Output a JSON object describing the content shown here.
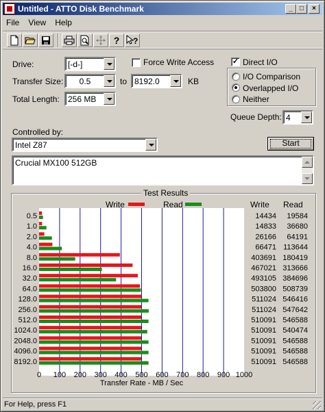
{
  "window": {
    "title": "Untitled - ATTO Disk Benchmark",
    "btn_min": "_",
    "btn_max": "□",
    "btn_close": "×"
  },
  "menu": {
    "file": "File",
    "view": "View",
    "help": "Help"
  },
  "toolbar": {
    "icons": [
      "new-document-icon",
      "open-folder-icon",
      "save-disk-icon",
      "print-icon",
      "print-preview-icon",
      "move-cross-icon",
      "help-question-icon",
      "context-help-icon"
    ]
  },
  "form": {
    "drive_label": "Drive:",
    "drive_value": "[-d-]",
    "force_write_label": "Force Write Access",
    "force_write_checked": false,
    "direct_io_label": "Direct I/O",
    "direct_io_checked": true,
    "transfer_size_label": "Transfer Size:",
    "transfer_from": "0.5",
    "to_label": "to",
    "transfer_to": "8192.0",
    "kb_label": "KB",
    "total_length_label": "Total Length:",
    "total_length_value": "256 MB",
    "io_comparison_label": "I/O Comparison",
    "overlapped_io_label": "Overlapped I/O",
    "neither_label": "Neither",
    "selected_mode": "Overlapped I/O",
    "queue_depth_label": "Queue Depth:",
    "queue_depth_value": "4",
    "controlled_by_label": "Controlled by:",
    "controlled_by_value": "Intel Z87",
    "start_button": "Start",
    "description": "Crucial MX100 512GB"
  },
  "results": {
    "title": "Test Results",
    "write_legend": "Write",
    "read_legend": "Read",
    "write_col_header": "Write",
    "read_col_header": "Read",
    "rows": [
      {
        "size": "0.5",
        "write": "14434",
        "read": "19584"
      },
      {
        "size": "1.0",
        "write": "14833",
        "read": "36680"
      },
      {
        "size": "2.0",
        "write": "26166",
        "read": "64191"
      },
      {
        "size": "4.0",
        "write": "66471",
        "read": "113644"
      },
      {
        "size": "8.0",
        "write": "403691",
        "read": "180419"
      },
      {
        "size": "16.0",
        "write": "467021",
        "read": "313666"
      },
      {
        "size": "32.0",
        "write": "493105",
        "read": "384696"
      },
      {
        "size": "64.0",
        "write": "503800",
        "read": "508739"
      },
      {
        "size": "128.0",
        "write": "511024",
        "read": "546416"
      },
      {
        "size": "256.0",
        "write": "511024",
        "read": "547642"
      },
      {
        "size": "512.0",
        "write": "510091",
        "read": "546588"
      },
      {
        "size": "1024.0",
        "write": "510091",
        "read": "540474"
      },
      {
        "size": "2048.0",
        "write": "510091",
        "read": "546588"
      },
      {
        "size": "4096.0",
        "write": "510091",
        "read": "546588"
      },
      {
        "size": "8192.0",
        "write": "510091",
        "read": "546588"
      }
    ]
  },
  "chart_data": {
    "type": "bar",
    "orientation": "horizontal",
    "categories": [
      "0.5",
      "1.0",
      "2.0",
      "4.0",
      "8.0",
      "16.0",
      "32.0",
      "64.0",
      "128.0",
      "256.0",
      "512.0",
      "1024.0",
      "2048.0",
      "4096.0",
      "8192.0"
    ],
    "series": [
      {
        "name": "Write",
        "color": "#e8151b",
        "values": [
          14.1,
          14.5,
          25.6,
          64.9,
          394.2,
          456.1,
          481.5,
          492.0,
          499.0,
          499.0,
          498.1,
          498.1,
          498.1,
          498.1,
          498.1
        ]
      },
      {
        "name": "Read",
        "color": "#1a8c1a",
        "values": [
          19.1,
          35.8,
          62.7,
          111.0,
          176.2,
          306.3,
          375.7,
          496.8,
          533.6,
          534.8,
          533.8,
          527.8,
          533.8,
          533.8,
          533.8
        ]
      }
    ],
    "xlim": [
      0,
      1000
    ],
    "xticks": [
      "0",
      "100",
      "200",
      "300",
      "400",
      "500",
      "600",
      "700",
      "800",
      "900",
      "1000"
    ],
    "xlabel": "Transfer Rate - MB / Sec",
    "grid": true
  },
  "status": {
    "text": "For Help, press F1"
  }
}
